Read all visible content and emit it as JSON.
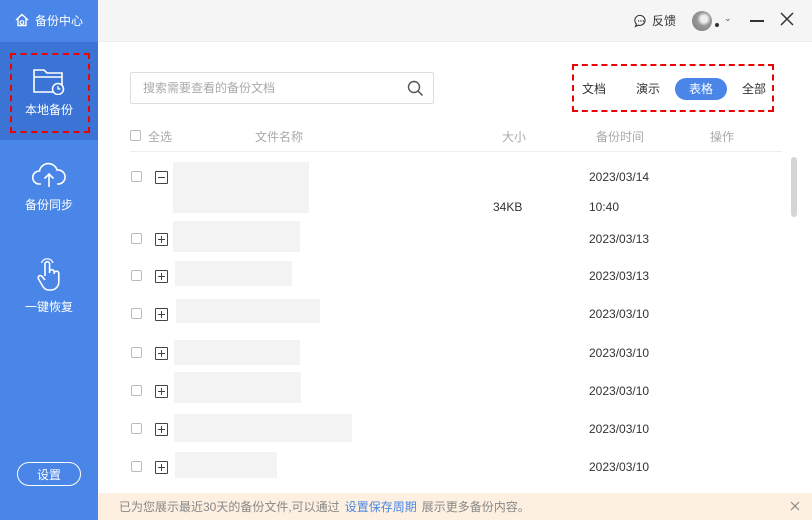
{
  "app": {
    "title": "备份中心"
  },
  "sidebar": {
    "items": [
      {
        "label": "本地备份",
        "icon": "folder-clock-icon",
        "active": true
      },
      {
        "label": "备份同步",
        "icon": "cloud-upload-icon"
      },
      {
        "label": "一键恢复",
        "icon": "hand-pointer-icon"
      }
    ],
    "settings_label": "设置"
  },
  "titlebar": {
    "feedback_label": "反馈"
  },
  "search": {
    "placeholder": "搜索需要查看的备份文档",
    "value": ""
  },
  "filters": [
    {
      "label": "文档"
    },
    {
      "label": "演示"
    },
    {
      "label": "表格",
      "selected": true
    },
    {
      "label": "全部"
    }
  ],
  "table": {
    "headers": {
      "select_all": "全选",
      "name": "文件名称",
      "size": "大小",
      "time": "备份时间",
      "actions": "操作"
    },
    "rows": [
      {
        "date": "2023/03/14",
        "size": "34KB",
        "time": "10:40",
        "expanded": true
      },
      {
        "date": "2023/03/13"
      },
      {
        "date": "2023/03/13"
      },
      {
        "date": "2023/03/10"
      },
      {
        "date": "2023/03/10"
      },
      {
        "date": "2023/03/10"
      },
      {
        "date": "2023/03/10"
      },
      {
        "date": "2023/03/10"
      }
    ]
  },
  "footer": {
    "text_before": "已为您展示最近30天的备份文件,可以通过",
    "link": "设置保存周期",
    "text_after": "展示更多备份内容。"
  },
  "colors": {
    "accent": "#4a86e8",
    "highlight": "#e00000",
    "banner": "#fdf0e0"
  }
}
